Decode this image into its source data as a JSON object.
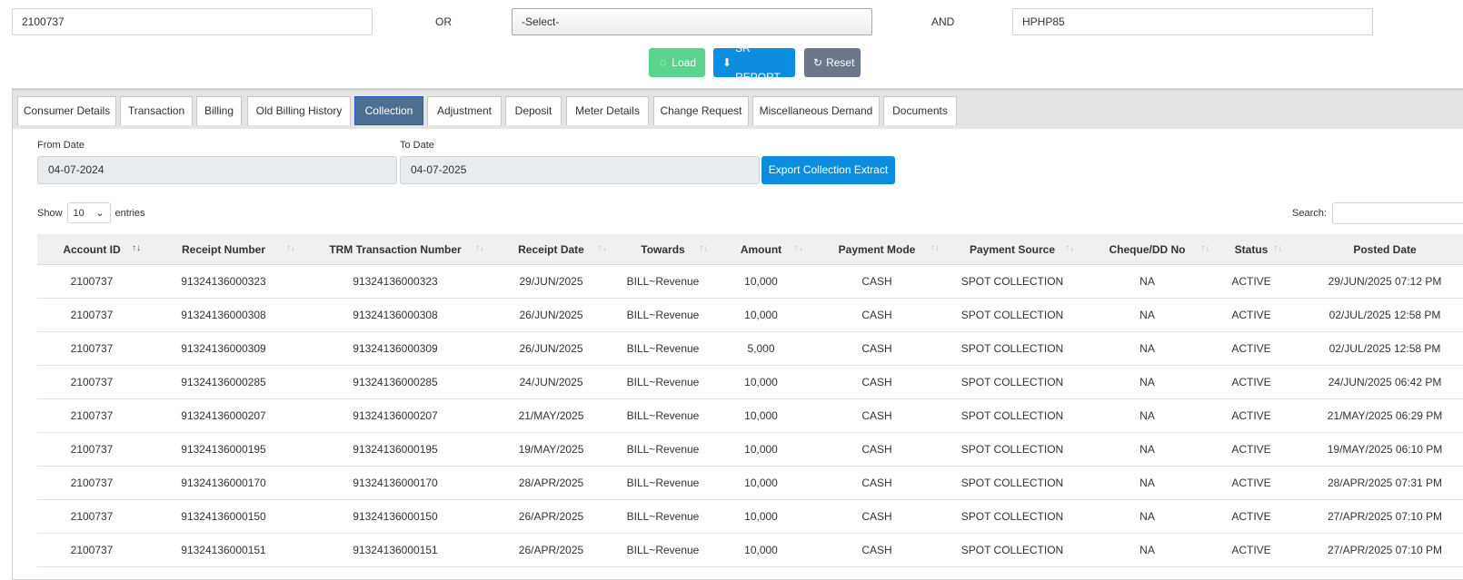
{
  "search": {
    "account_value": "2100737",
    "or_label": "OR",
    "select_value": "-Select-",
    "and_label": "AND",
    "code_value": "HPHP85"
  },
  "buttons": {
    "load_label": "Load",
    "sr_label": "SR REPORT",
    "reset_label": "Reset",
    "load_icon": "spinner-icon",
    "sr_icon": "download-circle-icon",
    "reset_icon": "refresh-icon"
  },
  "tabs": [
    {
      "label": "Consumer Details"
    },
    {
      "label": "Transaction"
    },
    {
      "label": "Billing"
    },
    {
      "label": "Old Billing History"
    },
    {
      "label": "Collection",
      "active": true
    },
    {
      "label": "Adjustment"
    },
    {
      "label": "Deposit"
    },
    {
      "label": "Meter Details"
    },
    {
      "label": "Change Request"
    },
    {
      "label": "Miscellaneous Demand"
    },
    {
      "label": "Documents"
    }
  ],
  "filters": {
    "from_label": "From Date",
    "from_value": "04-07-2024",
    "to_label": "To Date",
    "to_value": "04-07-2025",
    "export_label": "Export Collection Extract"
  },
  "table_controls": {
    "show_label": "Show",
    "entries_value": "10",
    "entries_label": "entries",
    "search_label": "Search:"
  },
  "table": {
    "columns": [
      "Account ID",
      "Receipt Number",
      "TRM Transaction Number",
      "Receipt Date",
      "Towards",
      "Amount",
      "Payment Mode",
      "Payment Source",
      "Cheque/DD No",
      "Status",
      "Posted Date"
    ],
    "rows": [
      [
        "2100737",
        "91324136000323",
        "91324136000323",
        "29/JUN/2025",
        "BILL~Revenue",
        "10,000",
        "CASH",
        "SPOT COLLECTION",
        "NA",
        "ACTIVE",
        "29/JUN/2025 07:12 PM"
      ],
      [
        "2100737",
        "91324136000308",
        "91324136000308",
        "26/JUN/2025",
        "BILL~Revenue",
        "10,000",
        "CASH",
        "SPOT COLLECTION",
        "NA",
        "ACTIVE",
        "02/JUL/2025 12:58 PM"
      ],
      [
        "2100737",
        "91324136000309",
        "91324136000309",
        "26/JUN/2025",
        "BILL~Revenue",
        "5,000",
        "CASH",
        "SPOT COLLECTION",
        "NA",
        "ACTIVE",
        "02/JUL/2025 12:58 PM"
      ],
      [
        "2100737",
        "91324136000285",
        "91324136000285",
        "24/JUN/2025",
        "BILL~Revenue",
        "10,000",
        "CASH",
        "SPOT COLLECTION",
        "NA",
        "ACTIVE",
        "24/JUN/2025 06:42 PM"
      ],
      [
        "2100737",
        "91324136000207",
        "91324136000207",
        "21/MAY/2025",
        "BILL~Revenue",
        "10,000",
        "CASH",
        "SPOT COLLECTION",
        "NA",
        "ACTIVE",
        "21/MAY/2025 06:29 PM"
      ],
      [
        "2100737",
        "91324136000195",
        "91324136000195",
        "19/MAY/2025",
        "BILL~Revenue",
        "10,000",
        "CASH",
        "SPOT COLLECTION",
        "NA",
        "ACTIVE",
        "19/MAY/2025 06:10 PM"
      ],
      [
        "2100737",
        "91324136000170",
        "91324136000170",
        "28/APR/2025",
        "BILL~Revenue",
        "10,000",
        "CASH",
        "SPOT COLLECTION",
        "NA",
        "ACTIVE",
        "28/APR/2025 07:31 PM"
      ],
      [
        "2100737",
        "91324136000150",
        "91324136000150",
        "26/APR/2025",
        "BILL~Revenue",
        "10,000",
        "CASH",
        "SPOT COLLECTION",
        "NA",
        "ACTIVE",
        "27/APR/2025 07:10 PM"
      ],
      [
        "2100737",
        "91324136000151",
        "91324136000151",
        "26/APR/2025",
        "BILL~Revenue",
        "10,000",
        "CASH",
        "SPOT COLLECTION",
        "NA",
        "ACTIVE",
        "27/APR/2025 07:10 PM"
      ]
    ]
  },
  "colors": {
    "load": "#5cd28f",
    "primary": "#0d8de0",
    "reset": "#6c7789",
    "active_tab": "#4d6f94"
  }
}
